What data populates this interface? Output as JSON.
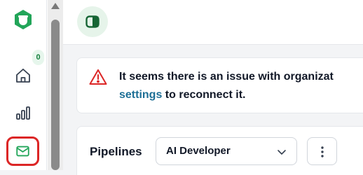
{
  "sidebar": {
    "notification_count": "0",
    "items": [
      {
        "icon": "home-icon"
      },
      {
        "icon": "bar-chart-icon"
      },
      {
        "icon": "mail-icon",
        "highlighted": true
      }
    ]
  },
  "topbar": {
    "toggle_icon": "panel-toggle-icon"
  },
  "alert": {
    "icon": "warning-triangle-icon",
    "line1": "It seems there is an issue with organizat",
    "link_text": "settings",
    "line2_rest": " to reconnect it."
  },
  "pipelines": {
    "label": "Pipelines",
    "selected": "AI Developer",
    "more_icon": "more-vertical-icon"
  },
  "colors": {
    "accent_green": "#22a559",
    "link_blue": "#1d6f96",
    "warning_red": "#dc2626",
    "highlight_border": "#dc2626"
  }
}
